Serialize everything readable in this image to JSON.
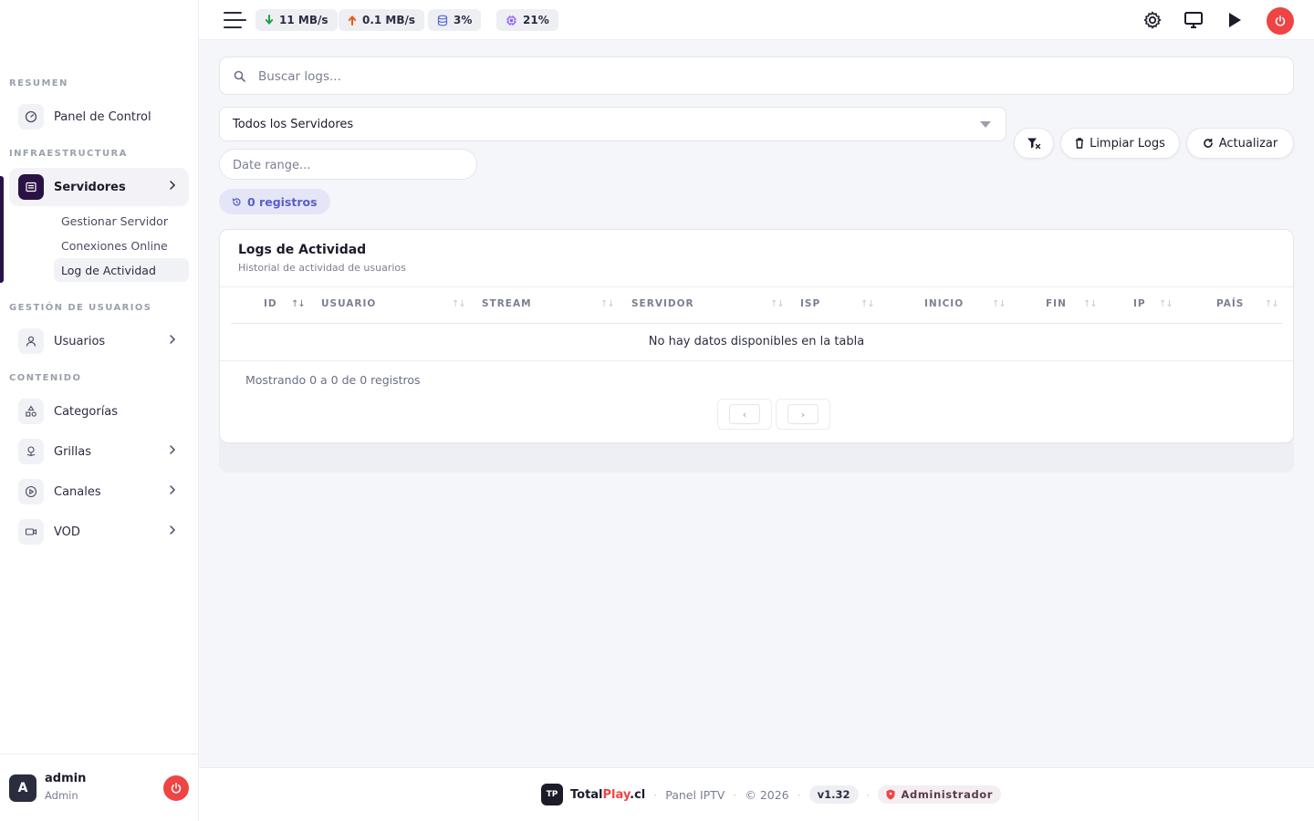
{
  "sidebar": {
    "groups": {
      "resumen": "RESUMEN",
      "infraestructura": "INFRAESTRUCTURA",
      "gestion_usuarios": "GESTIÓN DE USUARIOS",
      "contenido": "CONTENIDO"
    },
    "items": {
      "panel": "Panel de Control",
      "servidores": "Servidores",
      "usuarios": "Usuarios",
      "categorias": "Categorías",
      "grillas": "Grillas",
      "canales": "Canales",
      "vod": "VOD"
    },
    "submenu": {
      "gestionar": "Gestionar Servidor",
      "conexiones": "Conexiones Online",
      "log": "Log de Actividad"
    },
    "user": {
      "initial": "A",
      "name": "admin",
      "role": "Admin"
    }
  },
  "topbar": {
    "download": "11 MB/s",
    "upload": "0.1 MB/s",
    "disk": "3%",
    "cpu": "21%",
    "icons": [
      "settings-icon",
      "monitor-icon",
      "play-icon",
      "power-icon"
    ]
  },
  "filters": {
    "search_placeholder": "Buscar logs...",
    "server_select": "Todos los Servidores",
    "date_placeholder": "Date range...",
    "records": "0 registros",
    "clear_logs": "Limpiar Logs",
    "refresh": "Actualizar"
  },
  "table": {
    "title": "Logs de Actividad",
    "subtitle": "Historial de actividad de usuarios",
    "columns": [
      "ID",
      "USUARIO",
      "STREAM",
      "SERVIDOR",
      "ISP",
      "INICIO",
      "FIN",
      "IP",
      "PAÍS"
    ],
    "empty_message": "No hay datos disponibles en la tabla",
    "info": "Mostrando 0 a 0 de 0 registros",
    "prev": "‹",
    "next": "›"
  },
  "footer": {
    "logo": "TP",
    "brand_a": "Total",
    "brand_b": "Play",
    "brand_c": ".cl",
    "panel": "Panel IPTV",
    "copyright": "© 2026",
    "version": "v1.32",
    "role": "Administrador"
  },
  "colors": {
    "accent": "#2a1245",
    "danger": "#ef4444",
    "records_pill": "#5b5fc7",
    "download_arrow": "#16a34a",
    "upload_arrow": "#ea580c",
    "disk_icon": "#4f6bd8",
    "cpu_icon": "#8b5cf6"
  }
}
